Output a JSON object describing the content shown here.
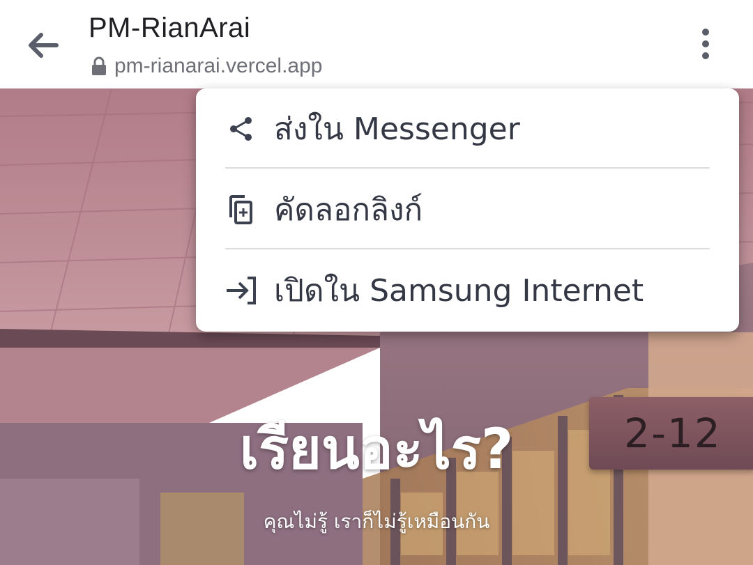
{
  "browser": {
    "title": "PM-RianArai",
    "url": "pm-rianarai.vercel.app",
    "back_icon": "arrow-left-icon",
    "lock_icon": "lock-icon",
    "more_icon": "more-vertical-icon"
  },
  "menu": {
    "items": [
      {
        "label": "ส่งใน Messenger",
        "icon": "share-icon"
      },
      {
        "label": "คัดลอกลิงก์",
        "icon": "copy-link-icon"
      },
      {
        "label": "เปิดใน Samsung Internet",
        "icon": "open-in-browser-icon"
      }
    ]
  },
  "page": {
    "hero_title": "เรียนอะไร?",
    "hero_subtitle": "คุณไม่รู้ เราก็ไม่รู้เหมือนกัน",
    "room_sign": "2-12"
  },
  "colors": {
    "menu_text": "#343845",
    "icon": "#3c4150",
    "title_text": "#1f1f24",
    "url_text": "#6f7077"
  }
}
